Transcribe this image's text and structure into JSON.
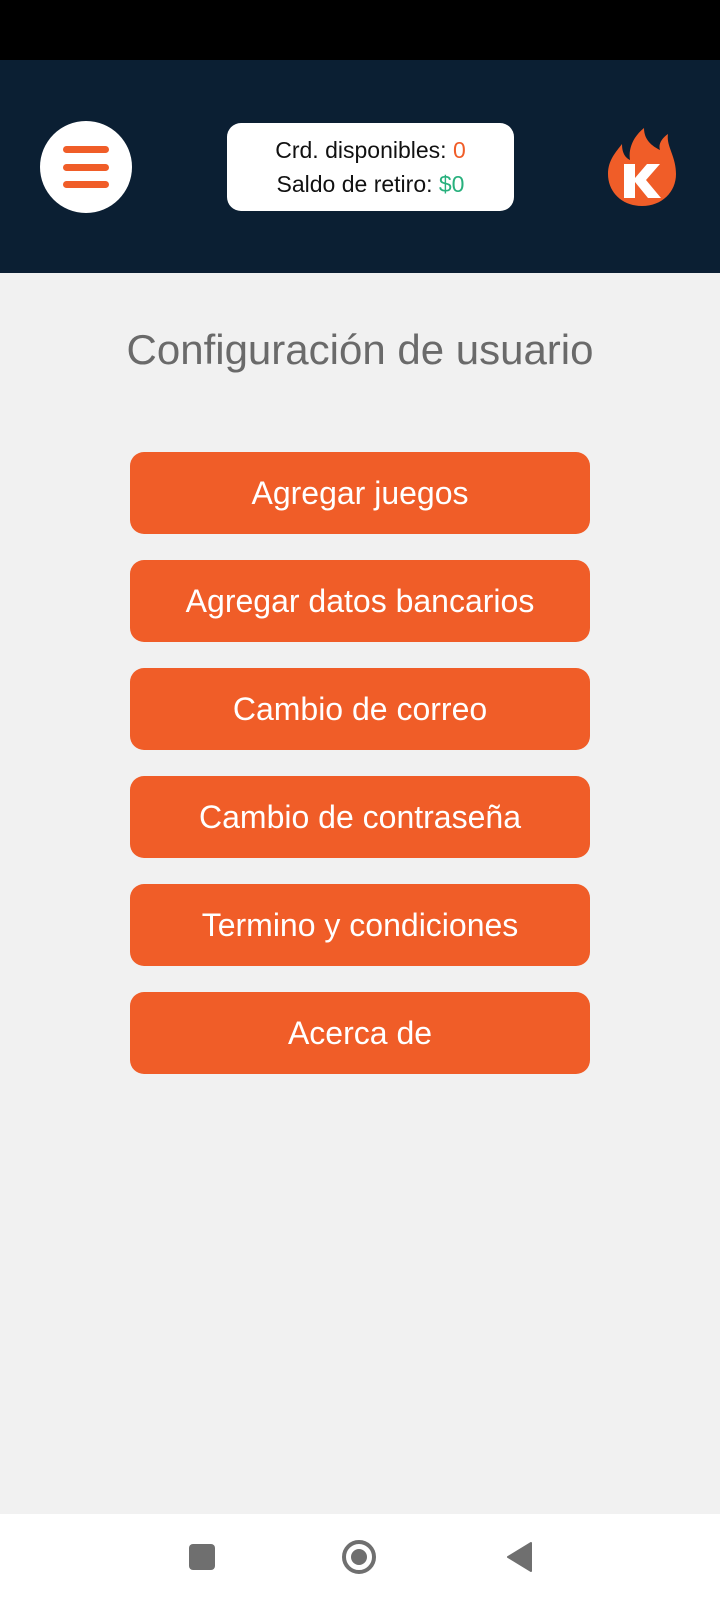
{
  "header": {
    "credits_label": "Crd. disponibles:",
    "credits_value": "0",
    "withdraw_label": "Saldo de retiro:",
    "withdraw_value": "$0"
  },
  "page": {
    "title": "Configuración de usuario"
  },
  "menu": [
    {
      "label": "Agregar juegos"
    },
    {
      "label": "Agregar datos bancarios"
    },
    {
      "label": "Cambio de correo"
    },
    {
      "label": "Cambio de contraseña"
    },
    {
      "label": "Termino y condiciones"
    },
    {
      "label": "Acerca de"
    }
  ],
  "icons": {
    "menu": "hamburger-icon",
    "logo": "flame-k-logo",
    "nav_recents": "square-icon",
    "nav_home": "circle-home-icon",
    "nav_back": "triangle-back-icon"
  },
  "colors": {
    "accent": "#f05d28",
    "header_bg": "#0b1f33",
    "page_bg": "#f1f1f1",
    "positive": "#28b07d"
  }
}
